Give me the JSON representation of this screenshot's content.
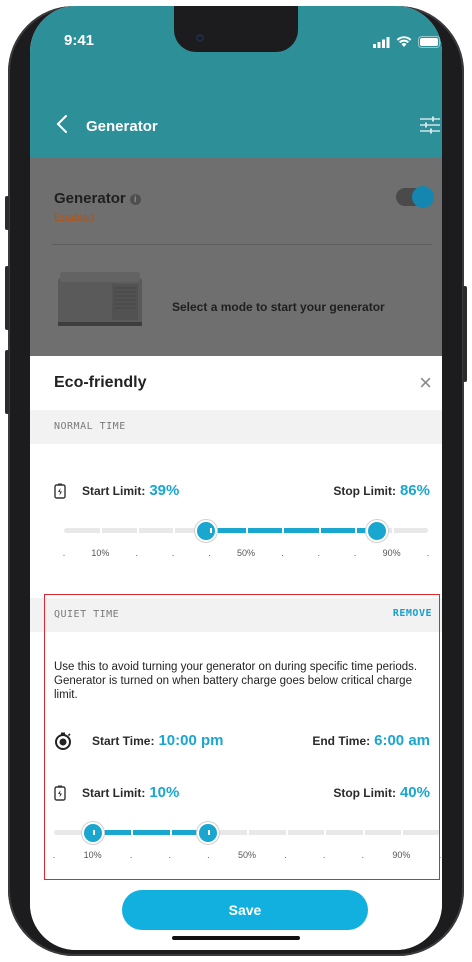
{
  "status": {
    "time": "9:41"
  },
  "header": {
    "title": "Generator"
  },
  "generator": {
    "title": "Generator",
    "info_icon": "i",
    "status": "Enabled",
    "toggle_on": true,
    "mode_prompt": "Select a mode to start your generator"
  },
  "sheet": {
    "title": "Eco-friendly",
    "close": "×",
    "normal_time": {
      "section_label": "NORMAL TIME",
      "start_label": "Start Limit:",
      "start_value": "39%",
      "stop_label": "Stop Limit:",
      "stop_value": "86%",
      "start_fraction": 0.39,
      "stop_fraction": 0.86,
      "tick_labels": [
        ".",
        "10%",
        ".",
        ".",
        ".",
        "50%",
        ".",
        ".",
        ".",
        "90%",
        "."
      ]
    },
    "quiet_time": {
      "section_label": "QUIET TIME",
      "remove_label": "REMOVE",
      "description": "Use this to avoid turning your generator on during specific time periods. Generator is turned on when battery charge goes below critical charge limit.",
      "start_time_label": "Start Time:",
      "start_time_value": "10:00 pm",
      "end_time_label": "End Time:",
      "end_time_value": "6:00 am",
      "start_label": "Start Limit:",
      "start_value": "10%",
      "stop_label": "Stop Limit:",
      "stop_value": "40%",
      "start_fraction": 0.1,
      "stop_fraction": 0.4,
      "tick_labels": [
        ".",
        "10%",
        ".",
        ".",
        ".",
        "50%",
        ".",
        ".",
        ".",
        "90%",
        "."
      ]
    },
    "save_label": "Save"
  },
  "colors": {
    "accent": "#19a6cf",
    "header": "#2d8f98",
    "highlight_box": "#e0272f",
    "enabled_text": "#b25316"
  },
  "icons": {
    "back": "chevron-left-icon",
    "filter": "sliders-icon",
    "battery": "battery-icon",
    "timer": "stopwatch-icon",
    "close": "close-icon"
  }
}
